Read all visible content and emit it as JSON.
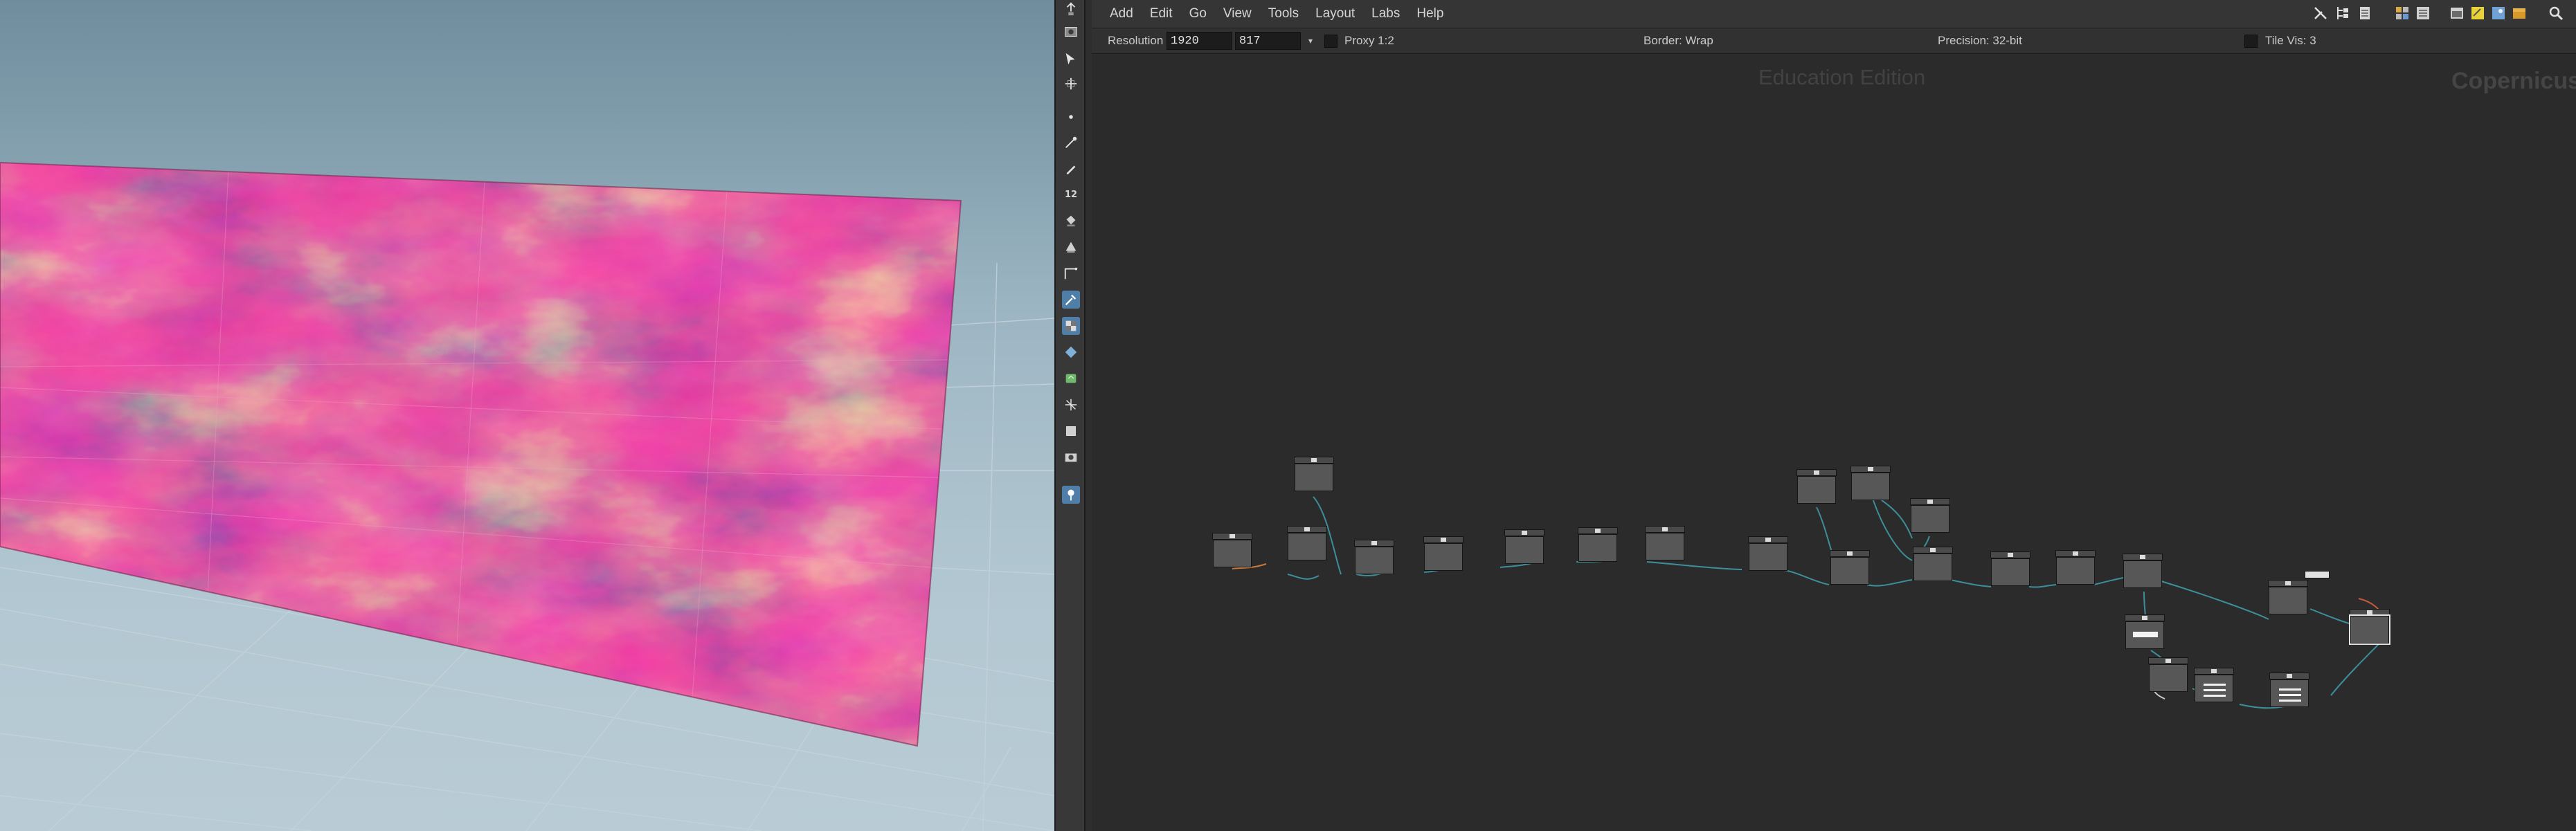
{
  "menubar": {
    "items": [
      "Add",
      "Edit",
      "Go",
      "View",
      "Tools",
      "Layout",
      "Labs",
      "Help"
    ]
  },
  "options": {
    "resolution_label": "Resolution",
    "resolution_width": "1920",
    "resolution_height": "817",
    "proxy_label": "Proxy 1:2",
    "border_label": "Border: Wrap",
    "precision_label": "Precision: 32-bit",
    "tile_vis_label": "Tile Vis: 3"
  },
  "network": {
    "watermark": "Education Edition",
    "context_name": "Copernicus"
  },
  "shelf": {
    "tools": [
      "handle-tool-icon",
      "view-tool-icon",
      "select-tool-icon",
      "transform-tool-icon",
      "point-icon",
      "brush-icon",
      "pen-icon",
      "number-icon",
      "bucket-icon",
      "paint-icon",
      "curve-icon",
      "eyedropper-icon",
      "checker-icon",
      "sphere-icon",
      "globe-icon",
      "wand-icon",
      "frame-icon",
      "camera-icon",
      "pin-icon"
    ],
    "number_text": "12"
  },
  "colors": {
    "accent": "#4f7fa8",
    "wire": "#3c8f9a",
    "texture_hot": "#f8c890",
    "texture_mid": "#d22570",
    "texture_dark": "#3a1660"
  }
}
